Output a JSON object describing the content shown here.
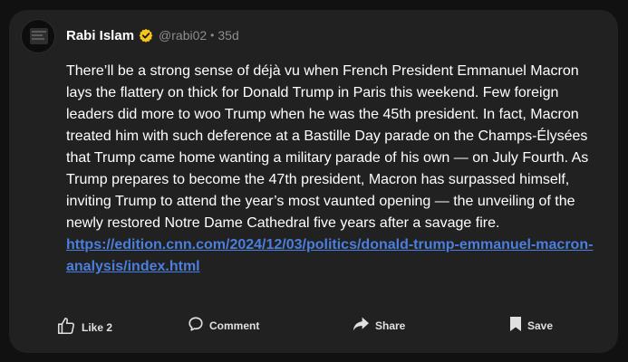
{
  "post": {
    "author_name": "Rabi Islam",
    "handle": "@rabi02",
    "separator": "•",
    "age": "35d",
    "text": "There’ll be a strong sense of déjà vu when French President Emmanuel Macron lays the flattery on thick for Donald Trump in Paris this weekend. Few foreign leaders did more to woo Trump when he was the 45th president. In fact, Macron treated him with such deference at a Bastille Day parade on the Champs-Élysées that Trump came home wanting a military parade of his own — on July Fourth. As Trump prepares to become the 47th president, Macron has surpassed himself, inviting Trump to attend the year’s most vaunted opening — the unveiling of the newly restored Notre Dame Cathedral five years after a savage fire. ",
    "link": "https://edition.cnn.com/2024/12/03/politics/donald-trump-emmanuel-macron-analysis/index.html"
  },
  "actions": {
    "like_label": "Like 2",
    "comment_label": "Comment",
    "share_label": "Share",
    "save_label": "Save"
  },
  "icons": {
    "verified": "verified-badge-icon",
    "like": "thumbs-up-icon",
    "comment": "comment-bubble-icon",
    "share": "share-arrow-icon",
    "save": "bookmark-icon"
  },
  "colors": {
    "background": "#111111",
    "card": "#212121",
    "link": "#4a7fe0",
    "verified": "#f5c518",
    "muted": "#8d8d8d"
  }
}
